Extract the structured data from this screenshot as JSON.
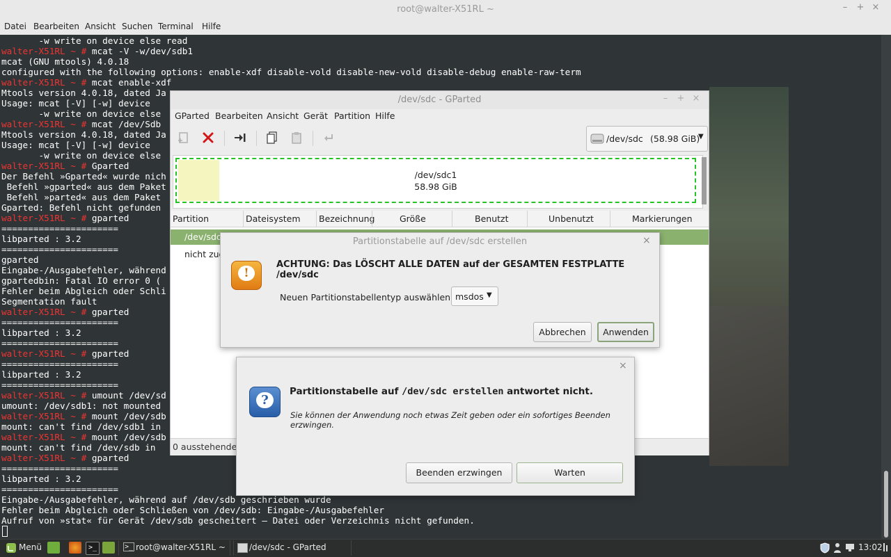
{
  "terminal": {
    "title": "root@walter-X51RL ~",
    "window_controls": [
      "–",
      "+",
      "×"
    ],
    "menu": [
      "Datei",
      "Bearbeiten",
      "Ansicht",
      "Suchen",
      "Terminal",
      "Hilfe"
    ],
    "prompt": "walter-X51RL ~ #",
    "lines": [
      {
        "p": "",
        "t": "       -w write on device else read"
      },
      {
        "p": "walter-X51RL ~ #",
        "t": " mcat -V -w/dev/sdb1"
      },
      {
        "p": "",
        "t": "mcat (GNU mtools) 4.0.18"
      },
      {
        "p": "",
        "t": "configured with the following options: enable-xdf disable-vold disable-new-vold disable-debug enable-raw-term"
      },
      {
        "p": "walter-X51RL ~ #",
        "t": " mcat enable-xdf"
      },
      {
        "p": "",
        "t": "Mtools version 4.0.18, dated Ja"
      },
      {
        "p": "",
        "t": "Usage: mcat [-V] [-w] device"
      },
      {
        "p": "",
        "t": "       -w write on device else"
      },
      {
        "p": "walter-X51RL ~ #",
        "t": " mcat /dev/Sdb"
      },
      {
        "p": "",
        "t": "Mtools version 4.0.18, dated Ja"
      },
      {
        "p": "",
        "t": "Usage: mcat [-V] [-w] device"
      },
      {
        "p": "",
        "t": "       -w write on device else"
      },
      {
        "p": "walter-X51RL ~ #",
        "t": " Gparted"
      },
      {
        "p": "",
        "t": "Der Befehl »Gparted« wurde nich"
      },
      {
        "p": "",
        "t": " Befehl »gparted« aus dem Paket"
      },
      {
        "p": "",
        "t": " Befehl »parted« aus dem Paket"
      },
      {
        "p": "",
        "t": "Gparted: Befehl nicht gefunden"
      },
      {
        "p": "walter-X51RL ~ #",
        "t": " gparted"
      },
      {
        "p": "",
        "t": "======================"
      },
      {
        "p": "",
        "t": "libparted : 3.2"
      },
      {
        "p": "",
        "t": "======================"
      },
      {
        "p": "",
        "t": "gparted"
      },
      {
        "p": "",
        "t": "Eingabe-/Ausgabefehler, während"
      },
      {
        "p": "",
        "t": "gpartedbin: Fatal IO error 0 ("
      },
      {
        "p": "",
        "t": "Fehler beim Abgleich oder Schli"
      },
      {
        "p": "",
        "t": "Segmentation fault"
      },
      {
        "p": "walter-X51RL ~ #",
        "t": " gparted"
      },
      {
        "p": "",
        "t": "======================"
      },
      {
        "p": "",
        "t": "libparted : 3.2"
      },
      {
        "p": "",
        "t": "======================"
      },
      {
        "p": "walter-X51RL ~ #",
        "t": " gparted"
      },
      {
        "p": "",
        "t": "======================"
      },
      {
        "p": "",
        "t": "libparted : 3.2"
      },
      {
        "p": "",
        "t": "======================"
      },
      {
        "p": "walter-X51RL ~ #",
        "t": " umount /dev/sd"
      },
      {
        "p": "",
        "t": "umount: /dev/sdb1: not mounted"
      },
      {
        "p": "walter-X51RL ~ #",
        "t": " mount /dev/sdb"
      },
      {
        "p": "",
        "t": "mount: can't find /dev/sdb1 in"
      },
      {
        "p": "walter-X51RL ~ #",
        "t": " mount /dev/sdb"
      },
      {
        "p": "",
        "t": "mount: can't find /dev/sdb in"
      },
      {
        "p": "walter-X51RL ~ #",
        "t": " gparted"
      },
      {
        "p": "",
        "t": "======================"
      },
      {
        "p": "",
        "t": "libparted : 3.2"
      },
      {
        "p": "",
        "t": "======================"
      },
      {
        "p": "",
        "t": "Eingabe-/Ausgabefehler, während auf /dev/sdb geschrieben wurde"
      },
      {
        "p": "",
        "t": "Fehler beim Abgleich oder Schließen von /dev/sdb: Eingabe-/Ausgabefehler"
      },
      {
        "p": "",
        "t": "Aufruf von »stat« für Gerät /dev/sdb gescheitert – Datei oder Verzeichnis nicht gefunden."
      }
    ]
  },
  "gparted": {
    "title": "/dev/sdc - GParted",
    "window_controls": [
      "–",
      "+",
      "×"
    ],
    "menu": [
      "GParted",
      "Bearbeiten",
      "Ansicht",
      "Gerät",
      "Partition",
      "Hilfe"
    ],
    "toolbar_icons": [
      "new-partition-icon",
      "delete-icon",
      "resize-move-icon",
      "copy-icon",
      "paste-icon",
      "undo-icon"
    ],
    "device": {
      "name": "/dev/sdc",
      "size": "(58.98 GiB)"
    },
    "graph": {
      "partition": "/dev/sdc1",
      "size": "58.98 GiB",
      "used_fraction": 0.08
    },
    "columns": [
      "Partition",
      "Dateisystem",
      "Bezeichnung",
      "Größe",
      "Benutzt",
      "Unbenutzt",
      "Markierungen"
    ],
    "rows": [
      {
        "partition": "/dev/sdc1"
      },
      {
        "partition": "nicht zuge"
      }
    ],
    "status": "0 ausstehende O"
  },
  "dialog_create": {
    "title": "Partitionstabelle auf /dev/sdc erstellen",
    "close": "×",
    "warning": "ACHTUNG:  Das LÖSCHT ALLE DATEN auf der GESAMTEN FESTPLATTE /dev/sdc",
    "label": "Neuen Partitionstabellentyp auswählen:",
    "selected_type": "msdos",
    "cancel": "Abbrechen",
    "apply": "Anwenden"
  },
  "dialog_not_responding": {
    "close": "×",
    "heading_pre": "Partitionstabelle auf ",
    "heading_mono": "/dev/sdc erstellen",
    "heading_post": " antwortet nicht.",
    "message": "Sie können der Anwendung noch etwas Zeit geben oder ein sofortiges Beenden erzwingen.",
    "force_quit": "Beenden erzwingen",
    "wait": "Warten"
  },
  "taskbar": {
    "menu_label": "Menü",
    "tasks": [
      "root@walter-X51RL ~",
      "/dev/sdc - GParted"
    ],
    "clock": "13:02"
  }
}
